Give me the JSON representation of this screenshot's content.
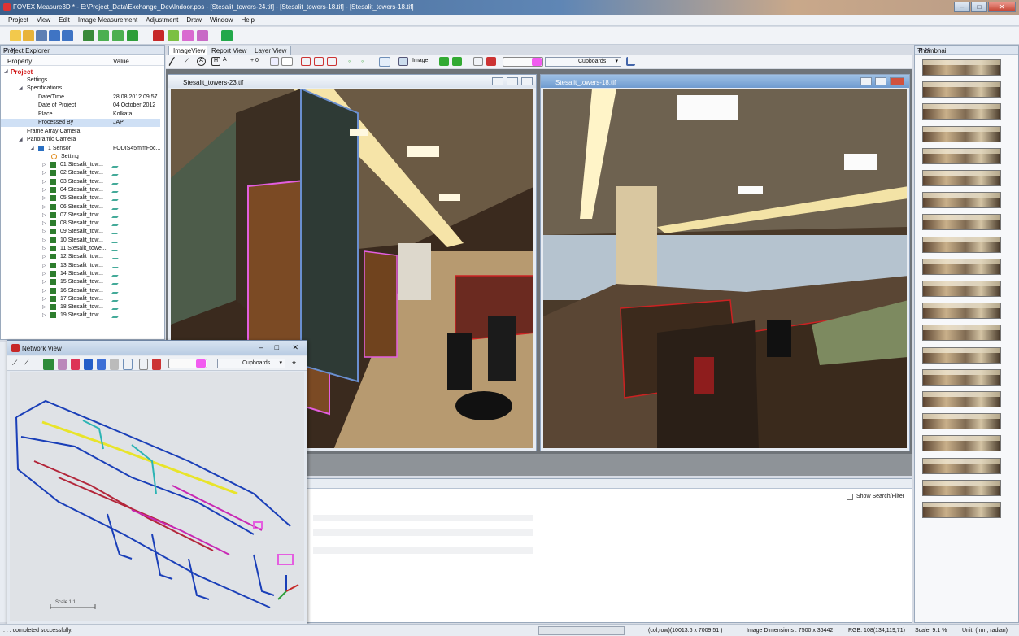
{
  "window": {
    "title": "FOVEX Measure3D * - E:\\Project_Data\\Exchange_Dev\\Indoor.pos - [Stesalit_towers-24.tif] - [Stesalit_towers-18.tif] - [Stesalit_towers-18.tif]",
    "minimize": "–",
    "maximize": "□",
    "close": "✕"
  },
  "menu": [
    "Project",
    "View",
    "Edit",
    "Image Measurement",
    "Adjustment",
    "Draw",
    "Window",
    "Help"
  ],
  "project_explorer": {
    "title": "Project Explorer",
    "pin": "⇗ ✕",
    "col_property": "Property",
    "col_value": "Value",
    "project": "Project",
    "settings": "Settings",
    "specifications": "Specifications",
    "specs": [
      {
        "label": "Date/Time",
        "value": "28.08.2012 09:57"
      },
      {
        "label": "Date of Project",
        "value": "04 October 2012"
      },
      {
        "label": "Place",
        "value": "Kolkata"
      },
      {
        "label": "Processed By",
        "value": "JAP"
      }
    ],
    "frame_array_camera": "Frame Array Camera",
    "panoramic_camera": "Panoramic Camera",
    "sensor": "1 Sensor",
    "sensor_value": "FODIS45mmFoc...",
    "setting": "Setting",
    "images": [
      "01 Stesalit_tow...",
      "02 Stesalit_tow...",
      "03 Stesalit_tow...",
      "04 Stesalit_tow...",
      "05 Stesalit_tow...",
      "06 Stesalit_tow...",
      "07 Stesalit_tow...",
      "08 Stesalit_tow...",
      "09 Stesalit_tow...",
      "10 Stesalit_tow...",
      "11 Stesalit_towe...",
      "12 Stesalit_tow...",
      "13 Stesalit_tow...",
      "14 Stesalit_tow...",
      "15 Stesalit_tow...",
      "16 Stesalit_tow...",
      "17 Stesalit_tow...",
      "18 Stesalit_tow...",
      "19 Stesalit_tow..."
    ]
  },
  "tabs": [
    "ImageView",
    "Report View",
    "Layer View"
  ],
  "image_toolbar": {
    "zoom_value": "+ 0",
    "image_label": "Image",
    "layer_dropdown": "Cupboards"
  },
  "image_windows": [
    {
      "title": "Stesalit_towers-23.tif"
    },
    {
      "title": "Stesalit_towers-18.tif"
    }
  ],
  "report_panel": {
    "pin": "⇗ ✕",
    "show_search_filter": "Show Search/Filter"
  },
  "thumbnail_panel": {
    "title": "Thumbnail",
    "pin": "⇗ ✕",
    "count": 21
  },
  "network_view": {
    "title": "Network View",
    "layer_dropdown": "Cupboards",
    "scale_label": "Scale 1:1"
  },
  "status_bar": {
    "message": ". . . completed successfully.",
    "coords": "(col,row)(10013.6 x 7009.51 )",
    "dimensions": "Image Dimensions : 7500 x 36442",
    "rgb": "RGB: 108(134,119,71)",
    "scale": "Scale: 9.1 %",
    "unit": "Unit: (mm, radian)"
  },
  "colors": {
    "accent": "#3b5f8c",
    "selection": "#cfe0f5",
    "project_red": "#d11a1a",
    "tree_icon_green": "#2d7d2d",
    "net_blue": "#1a3fb8",
    "net_red": "#b3263a",
    "net_magenta": "#c828b4",
    "net_yellow": "#e8e42a"
  }
}
